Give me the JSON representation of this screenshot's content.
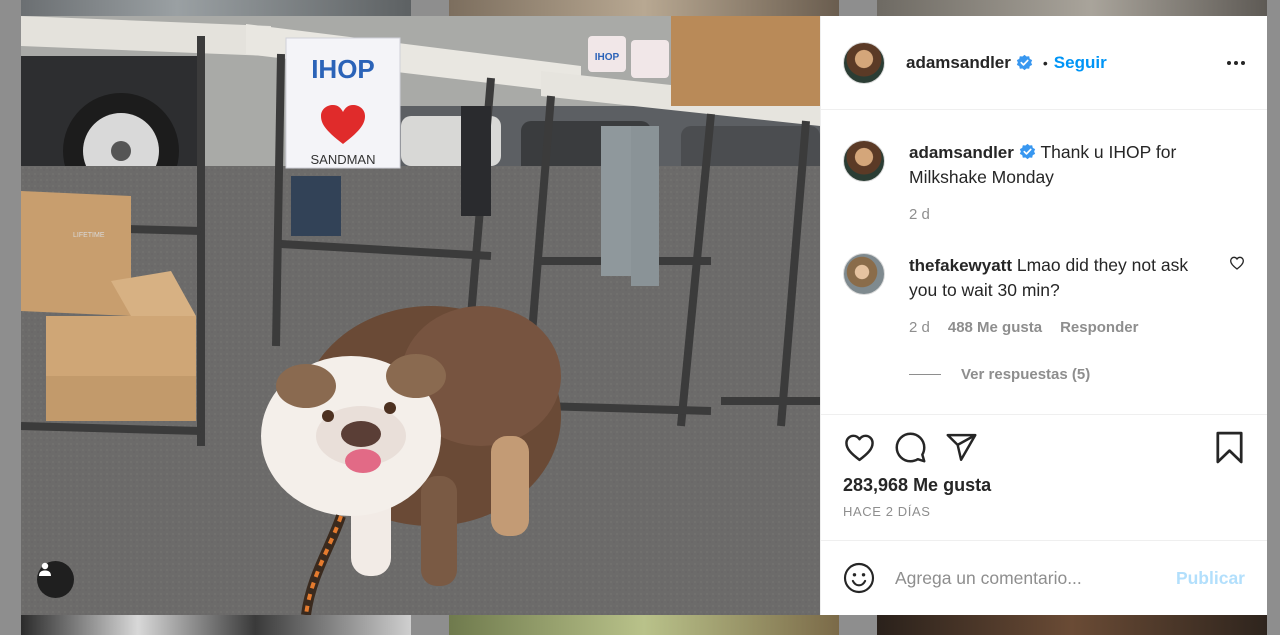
{
  "post": {
    "author": "adamsandler",
    "follow_label": "Seguir",
    "dot": "•",
    "photo_texts": {
      "sign_brand": "IHOP",
      "sign_caption": "SANDMAN",
      "cup_brand": "IHOP",
      "table_brand": "LIFETIME"
    }
  },
  "caption": {
    "username": "adamsandler",
    "text": "Thank u IHOP for Milkshake Monday",
    "age": "2 d"
  },
  "comments": [
    {
      "username": "thefakewyatt",
      "text": "Lmao did they not ask you to wait 30 min?",
      "age": "2 d",
      "likes": "488 Me gusta",
      "reply_label": "Responder",
      "view_replies": "Ver respuestas (5)"
    }
  ],
  "engagement": {
    "likes": "283,968 Me gusta",
    "timestamp": "HACE 2 DÍAS"
  },
  "composer": {
    "placeholder": "Agrega un comentario...",
    "post_label": "Publicar"
  },
  "colors": {
    "accent": "#0095f6",
    "post_disabled": "#b2dffc",
    "verified": "#3897f0",
    "text": "#262626",
    "muted": "#8e8e8e"
  },
  "icons": [
    "verified-badge-icon",
    "more-options-icon",
    "heart-icon",
    "comment-icon",
    "share-icon",
    "bookmark-icon",
    "emoji-icon",
    "user-tag-icon"
  ]
}
